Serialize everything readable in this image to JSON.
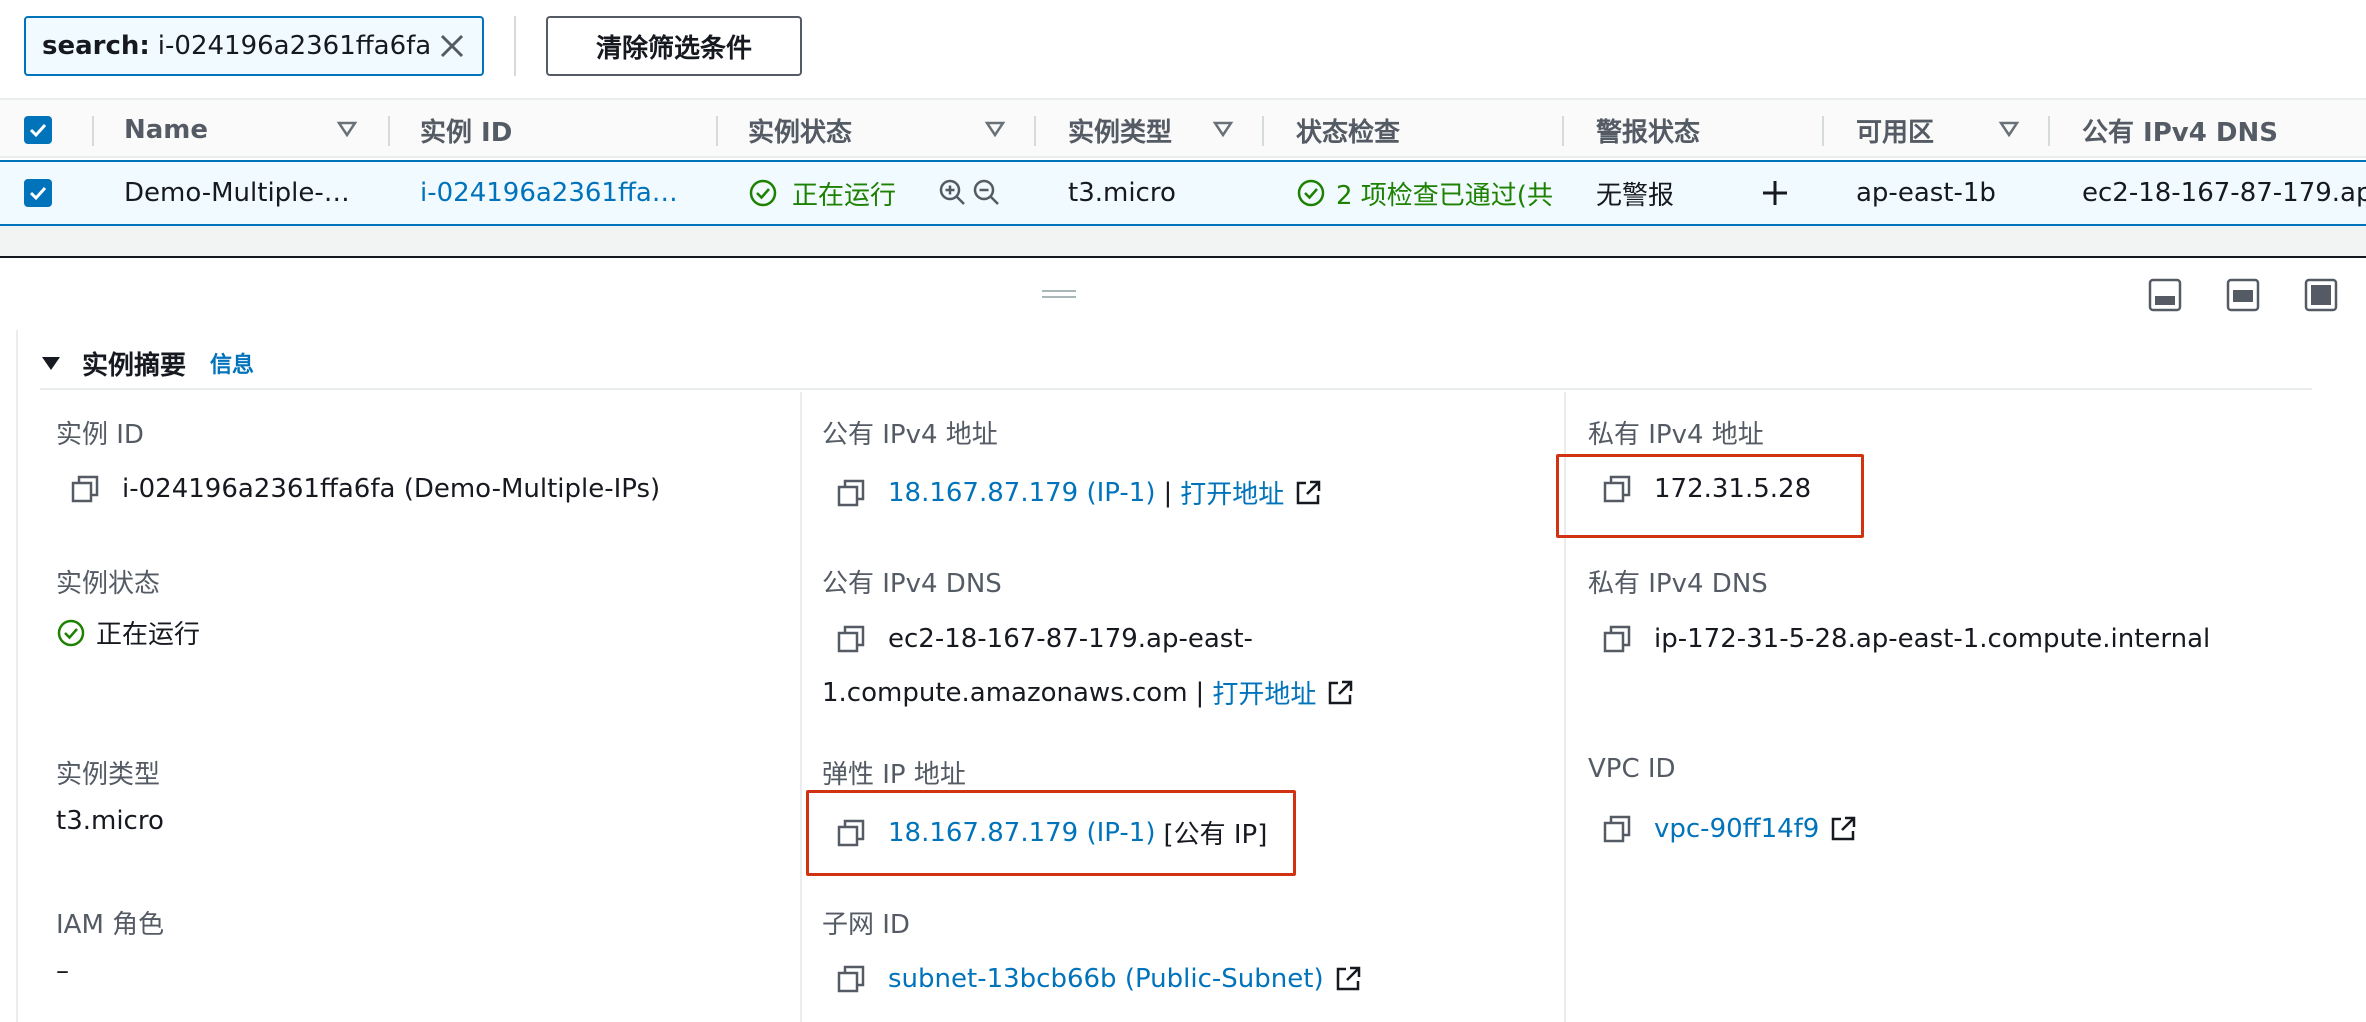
{
  "filter": {
    "search_key": "search:",
    "search_value": "i-024196a2361ffa6fa",
    "clear_button": "清除筛选条件"
  },
  "table": {
    "columns": [
      "Name",
      "实例 ID",
      "实例状态",
      "实例类型",
      "状态检查",
      "警报状态",
      "可用区",
      "公有 IPv4 DNS"
    ],
    "row": {
      "name": "Demo-Multiple-…",
      "instance_id": "i-024196a2361ffa…",
      "state": "正在运行",
      "type": "t3.micro",
      "status_check": "2 项检查已通过(共",
      "alarm": "无警报",
      "az": "ap-east-1b",
      "public_dns": "ec2-18-167-87-179.ap"
    }
  },
  "summary": {
    "title": "实例摘要",
    "info_link": "信息",
    "instance_id_label": "实例 ID",
    "instance_id_value": "i-024196a2361ffa6fa (Demo-Multiple-IPs)",
    "state_label": "实例状态",
    "state_value": "正在运行",
    "type_label": "实例类型",
    "type_value": "t3.micro",
    "iam_label": "IAM 角色",
    "iam_value": "–",
    "public_ip_label": "公有 IPv4 地址",
    "public_ip_value": "18.167.87.179 (IP-1)",
    "open_address": "打开地址",
    "public_dns_label": "公有 IPv4 DNS",
    "public_dns_line1": "ec2-18-167-87-179.ap-east-",
    "public_dns_line2": "1.compute.amazonaws.com",
    "elastic_ip_label": "弹性 IP 地址",
    "elastic_ip_value": "18.167.87.179 (IP-1)",
    "elastic_ip_suffix": "[公有 IP]",
    "subnet_label": "子网 ID",
    "subnet_value": "subnet-13bcb66b (Public-Subnet)",
    "private_ip_label": "私有 IPv4 地址",
    "private_ip_value": "172.31.5.28",
    "private_dns_label": "私有 IPv4 DNS",
    "private_dns_value": "ip-172-31-5-28.ap-east-1.compute.internal",
    "vpc_label": "VPC ID",
    "vpc_value": "vpc-90ff14f9",
    "separator": "|"
  },
  "colors": {
    "link": "#0073bb",
    "success": "#1d8102",
    "highlight": "#d13212"
  }
}
